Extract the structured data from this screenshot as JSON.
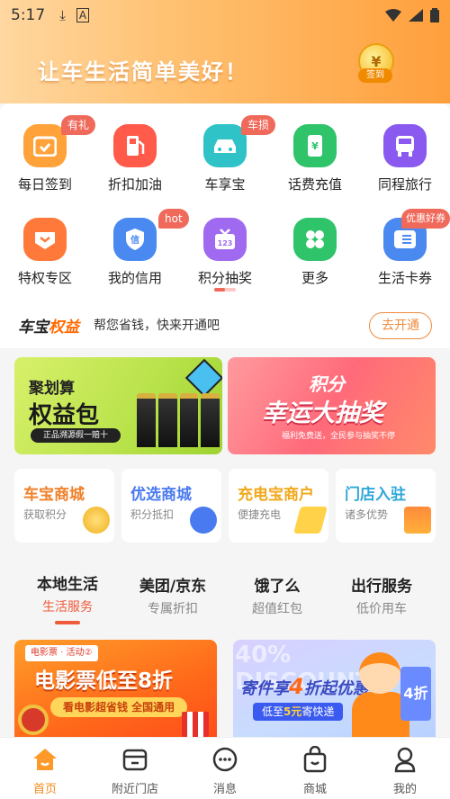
{
  "status_bar": {
    "time": "5:17",
    "icons": [
      "download-icon",
      "keyboard-icon",
      "wifi-icon",
      "signal-icon",
      "battery-icon"
    ]
  },
  "hero": {
    "slogan": "让车生活简单美好！",
    "signin_label": "签到",
    "colors": {
      "from": "#ffd7a0",
      "to": "#ff9f3c"
    }
  },
  "grid": [
    {
      "label": "每日签到",
      "icon": "calendar-icon",
      "color": "#ffa23a",
      "badge": "有礼"
    },
    {
      "label": "折扣加油",
      "icon": "fuel-pump-icon",
      "color": "#ff5a4a",
      "badge": ""
    },
    {
      "label": "车享宝",
      "icon": "car-icon",
      "color": "#2fc3c8",
      "badge": "车损"
    },
    {
      "label": "话费充值",
      "icon": "phone-recharge-icon",
      "color": "#2fc46a",
      "badge": ""
    },
    {
      "label": "同程旅行",
      "icon": "bus-icon",
      "color": "#8a5af0",
      "badge": ""
    },
    {
      "label": "特权专区",
      "icon": "heart-badge-icon",
      "color": "#ff7a3a",
      "badge": ""
    },
    {
      "label": "我的信用",
      "icon": "credit-shield-icon",
      "color": "#4a8af0",
      "badge": "hot"
    },
    {
      "label": "积分抽奖",
      "icon": "gift-box-icon",
      "color": "#a06af0",
      "badge": ""
    },
    {
      "label": "更多",
      "icon": "clover-icon",
      "color": "#2fc46a",
      "badge": ""
    },
    {
      "label": "生活卡券",
      "icon": "coupon-icon",
      "color": "#4a8af0",
      "badge": "优惠好券"
    }
  ],
  "benefit": {
    "brand_a": "车宝",
    "brand_b": "权益",
    "desc": "帮您省钱，快来开通吧",
    "button": "去开通"
  },
  "banners": [
    {
      "title": "聚划算",
      "headline": "权益包",
      "sub": "正品溯源假一赔十"
    },
    {
      "title": "积分",
      "headline": "幸运大抽奖",
      "sub": "福利免费送，全民参与抽奖不停"
    }
  ],
  "cards": [
    {
      "title": "车宝商城",
      "sub": "获取积分",
      "color": "#f0802a"
    },
    {
      "title": "优选商城",
      "sub": "积分抵扣",
      "color": "#4a7af0"
    },
    {
      "title": "充电宝商户",
      "sub": "便捷充电",
      "color": "#f0a81a"
    },
    {
      "title": "门店入驻",
      "sub": "诸多优势",
      "color": "#2fa8d8"
    }
  ],
  "tabs": [
    {
      "title": "本地生活",
      "sub": "生活服务",
      "active": true
    },
    {
      "title": "美团/京东",
      "sub": "专属折扣",
      "active": false
    },
    {
      "title": "饿了么",
      "sub": "超值红包",
      "active": false
    },
    {
      "title": "出行服务",
      "sub": "低价用车",
      "active": false
    }
  ],
  "promos": [
    {
      "tag": "电影票 · 活动②",
      "title": "电影票低至8折",
      "sub": "看电影超省钱 全国通用"
    },
    {
      "bg_text": "40% DISCOUNT",
      "title_a": "寄件享",
      "title_b": "4",
      "title_c": "折起优惠",
      "sub_a": "低至",
      "sub_b": "5元",
      "sub_c": "寄快递",
      "ticket": "4折"
    }
  ],
  "nav": [
    {
      "label": "首页",
      "icon": "home-icon",
      "active": true
    },
    {
      "label": "附近门店",
      "icon": "store-icon",
      "active": false
    },
    {
      "label": "消息",
      "icon": "message-icon",
      "active": false
    },
    {
      "label": "商城",
      "icon": "shopping-bag-icon",
      "active": false
    },
    {
      "label": "我的",
      "icon": "profile-icon",
      "active": false
    }
  ]
}
